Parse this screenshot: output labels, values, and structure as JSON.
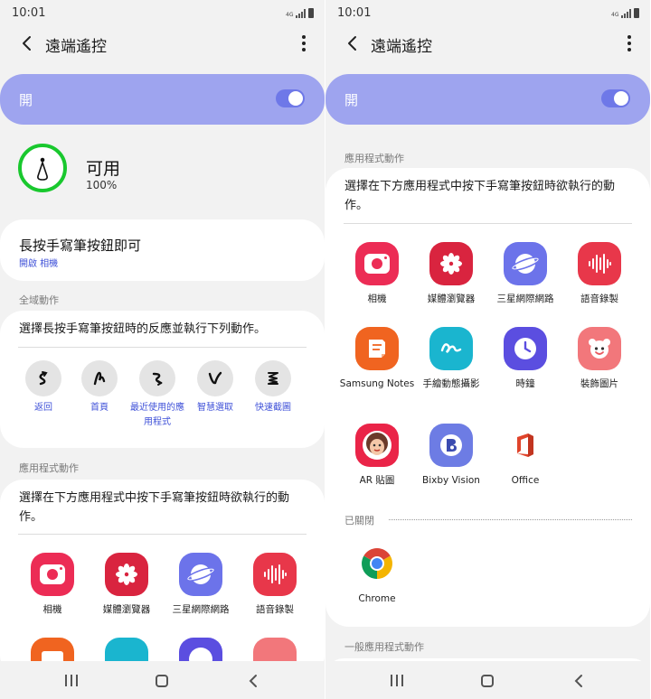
{
  "status_bar": {
    "time": "10:01",
    "network": "4G"
  },
  "header": {
    "title": "遠端遙控"
  },
  "master_switch": {
    "label": "開",
    "on": true
  },
  "pen": {
    "availability": "可用",
    "battery": "100%"
  },
  "long_press": {
    "title": "長按手寫筆按鈕即可",
    "subtitle": "開啟 相機"
  },
  "global_actions": {
    "header": "全域動作",
    "description": "選擇長按手寫筆按鈕時的反應並執行下列動作。",
    "gestures": [
      {
        "label": "返回",
        "icon": "back-gesture-icon"
      },
      {
        "label": "首頁",
        "icon": "home-gesture-icon"
      },
      {
        "label": "最近使用的應用程式",
        "icon": "recent-apps-gesture-icon"
      },
      {
        "label": "智慧選取",
        "icon": "smart-select-gesture-icon"
      },
      {
        "label": "快速截圖",
        "icon": "screenshot-gesture-icon"
      }
    ]
  },
  "app_actions": {
    "header": "應用程式動作",
    "description": "選擇在下方應用程式中按下手寫筆按鈕時欲執行的動作。",
    "apps": [
      {
        "name": "相機",
        "icon": "camera-icon"
      },
      {
        "name": "媒體瀏覽器",
        "icon": "gallery-icon"
      },
      {
        "name": "三星網際網路",
        "icon": "samsung-internet-icon"
      },
      {
        "name": "語音錄製",
        "icon": "voice-recorder-icon"
      },
      {
        "name": "Samsung Notes",
        "icon": "samsung-notes-icon"
      },
      {
        "name": "手繪動態攝影",
        "icon": "live-message-icon"
      },
      {
        "name": "時鐘",
        "icon": "clock-icon"
      },
      {
        "name": "裝飾圖片",
        "icon": "ar-decorate-icon"
      },
      {
        "name": "AR 貼圖",
        "icon": "ar-emoji-icon"
      },
      {
        "name": "Bixby Vision",
        "icon": "bixby-vision-icon"
      },
      {
        "name": "Office",
        "icon": "office-icon"
      }
    ],
    "closed_header": "已關閉",
    "closed_apps": [
      {
        "name": "Chrome",
        "icon": "chrome-icon"
      }
    ]
  },
  "general_actions": {
    "header": "一般應用程式動作"
  },
  "colors": {
    "accent": "#3f51d8",
    "master_bg": "#9ea4ef",
    "pen_ring": "#19c82e"
  }
}
